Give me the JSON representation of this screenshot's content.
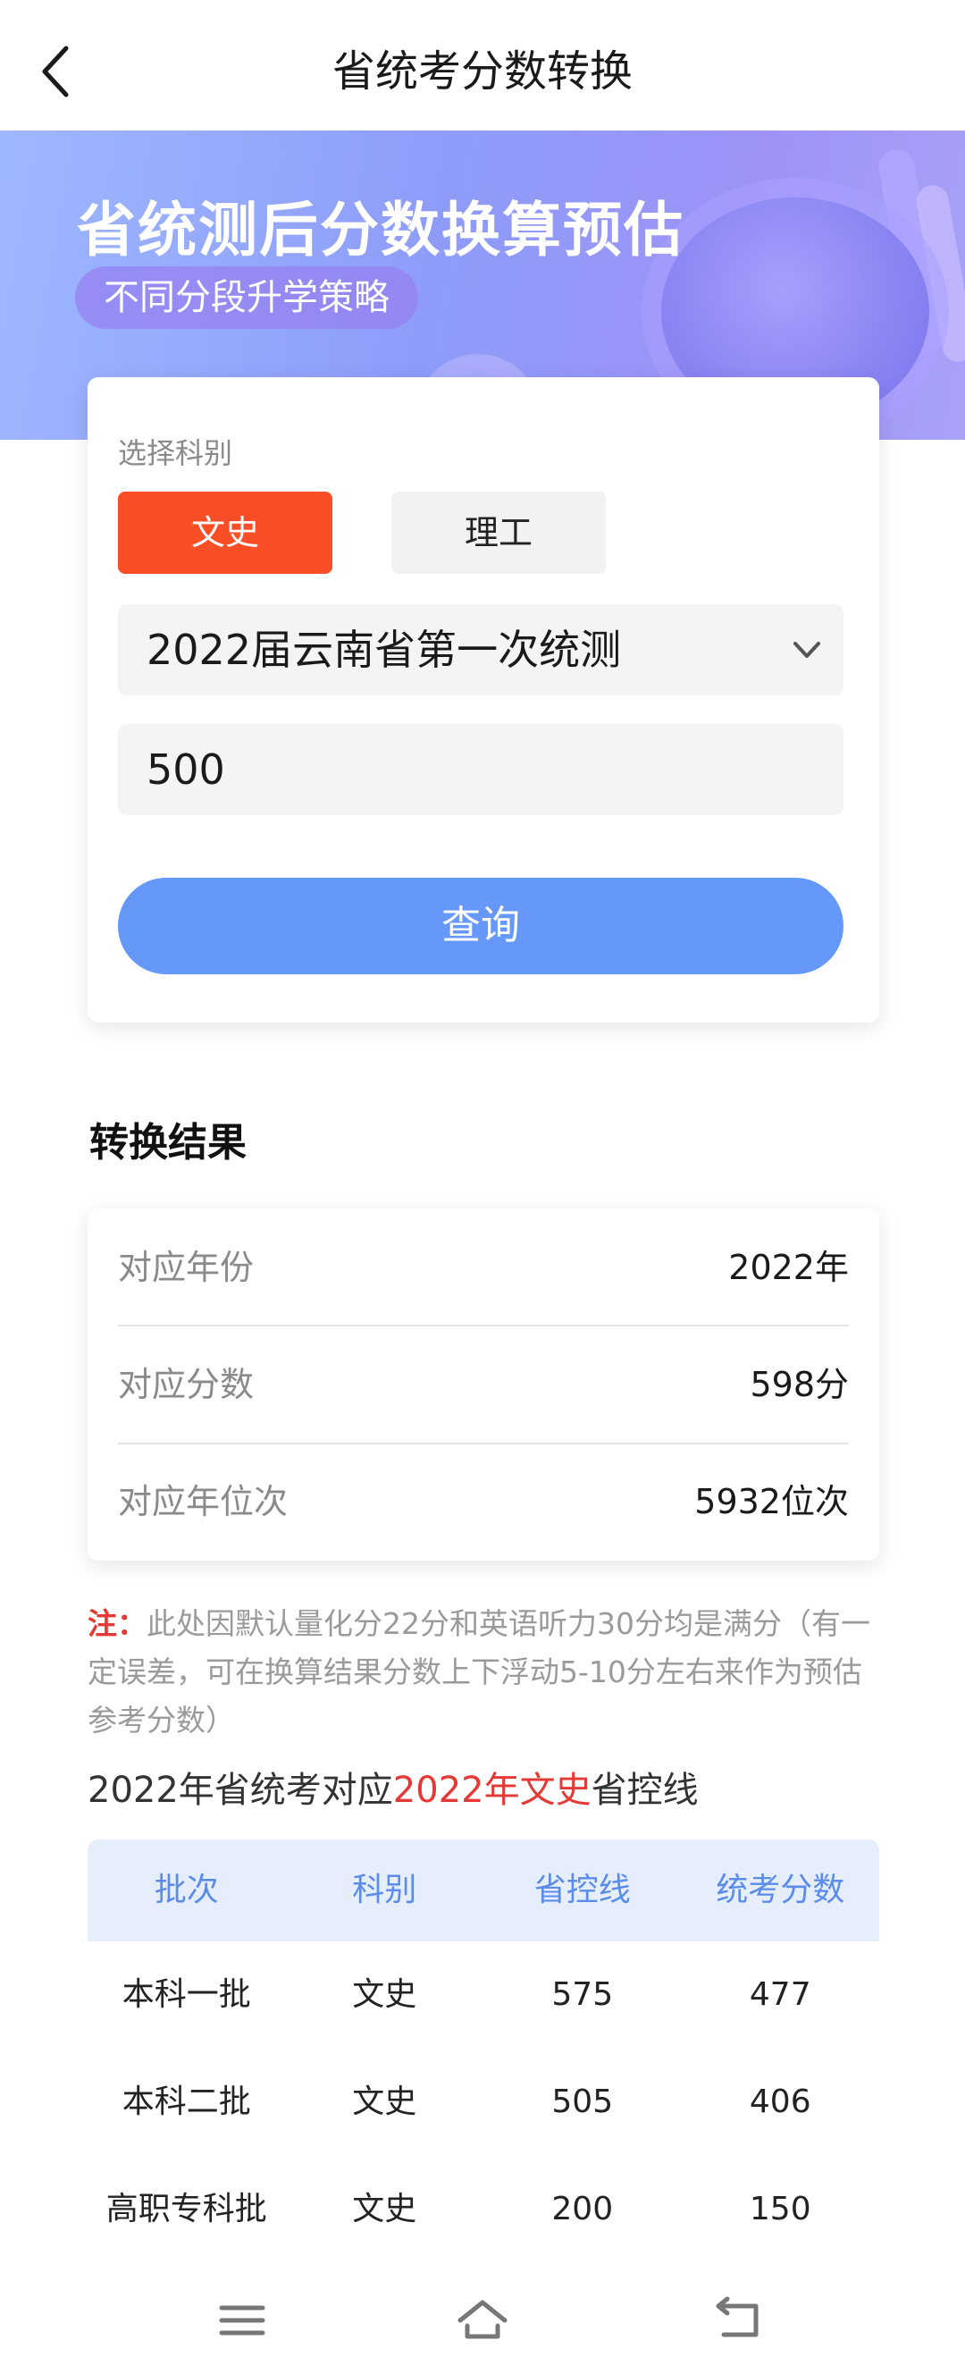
{
  "header": {
    "title": "省统考分数转换",
    "back_icon": "back-arrow-icon"
  },
  "banner": {
    "title": "省统测后分数换算预估",
    "subtitle": "不同分段升学策略"
  },
  "form": {
    "subject_label": "选择科别",
    "subjects": [
      "文史",
      "理工"
    ],
    "selected_subject": "文史",
    "exam_value": "2022届云南省第一次统测",
    "score_value": "500",
    "query_label": "查询"
  },
  "results": {
    "title": "转换结果",
    "rows": [
      {
        "label": "对应年份",
        "value": "2022年"
      },
      {
        "label": "对应分数",
        "value": "598分"
      },
      {
        "label": "对应年位次",
        "value": "5932位次"
      }
    ]
  },
  "note": {
    "prefix": "注：",
    "text": "此处因默认量化分22分和英语听力30分均是满分（有一定误差，可在换算结果分数上下浮动5-10分左右来作为预估参考分数）"
  },
  "control_line": {
    "heading_before": "2022年省统考对应",
    "heading_highlight": "2022年文史",
    "heading_after": "省控线",
    "columns": [
      "批次",
      "科别",
      "省控线",
      "统考分数"
    ],
    "rows": [
      [
        "本科一批",
        "文史",
        "575",
        "477"
      ],
      [
        "本科二批",
        "文史",
        "505",
        "406"
      ],
      [
        "高职专科批",
        "文史",
        "200",
        "150"
      ]
    ]
  },
  "colors": {
    "accent_orange": "#fa4e26",
    "primary_blue": "#6598f8",
    "highlight_red": "#e53935",
    "table_header_bg": "#e6eefc",
    "table_header_text": "#5b8cea"
  },
  "navbar": {
    "icons": [
      "menu-icon",
      "home-icon",
      "return-icon"
    ]
  }
}
